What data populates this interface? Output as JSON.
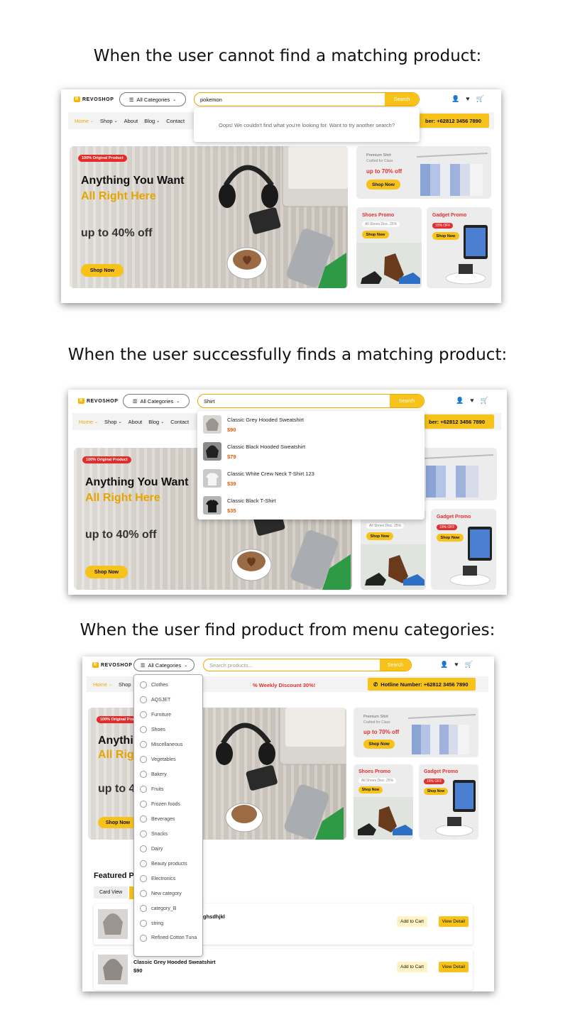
{
  "captions": {
    "one": "When the user cannot find a matching product:",
    "two": "When the user successfully finds a matching product:",
    "three": "When the user find product from menu categories:"
  },
  "brand": {
    "name": "REVOSHOP"
  },
  "header": {
    "categories_label": "All Categories",
    "search_button": "Search",
    "search_placeholder": "Search products..."
  },
  "nav": {
    "items": [
      "Home",
      "Shop",
      "About",
      "Blog",
      "Contact"
    ],
    "hotline_full": "Hotline Number: +62812 3456 7890",
    "hotline_cut": "ber: +62812 3456 7890",
    "discount": "Weekly Discount 30%!"
  },
  "hero": {
    "badge": "100% Original Product",
    "line1": "Anything You Want",
    "line2": "All Right Here",
    "offer": "up to 40% off",
    "cta": "Shop Now"
  },
  "promo_shirt": {
    "title": "Premium Shirt",
    "subtitle": "Crafted for Class",
    "offer": "up to 70% off",
    "cta": "Shop Now"
  },
  "promo_shoes": {
    "title": "Shoes Promo",
    "subtitle": "All Shoes Disc. 25%",
    "cta": "Shop Now"
  },
  "promo_gadget": {
    "title": "Gadget Promo",
    "badge": "15% OFF",
    "cta": "Shop Now"
  },
  "screen1": {
    "search_value": "pokemon",
    "not_found": "Oops! We couldn't find what you're looking for. Want to try another search?"
  },
  "screen2": {
    "search_value": "Shirt",
    "results": [
      {
        "name": "Classic Grey Hooded Sweatshirt",
        "price": "$90"
      },
      {
        "name": "Classic Black Hooded Sweatshirt",
        "price": "$79"
      },
      {
        "name": "Classic White Crew Neck T-Shirt 123",
        "price": "$39"
      },
      {
        "name": "Classic Black T-Shirt",
        "price": "$35"
      }
    ]
  },
  "screen3": {
    "categories": [
      "Clothes",
      "AQSJET",
      "Furniture",
      "Shoes",
      "Miscellaneous",
      "Vegetables",
      "Bakery",
      "Fruits",
      "Frozen foods",
      "Beverages",
      "Snacks",
      "Dairy",
      "Beauty products",
      "Electronics",
      "New category",
      "category_B",
      "string",
      "Refined Cotton Tuna"
    ],
    "featured_cut": "Featured P",
    "view_card": "Card View",
    "hero_cut1": "Anythi",
    "hero_cut2": "All Rig",
    "hero_cut3": "up to 4",
    "products": [
      {
        "name": "ghsdhjkl",
        "price": ""
      },
      {
        "name": "Classic Grey Hooded Sweatshirt",
        "price": "$90"
      }
    ],
    "add_to_cart": "Add to Cart",
    "view_detail": "View Detail"
  },
  "colors": {
    "accent": "#f7c31a",
    "sale": "#e23030",
    "price": "#e35a00"
  }
}
